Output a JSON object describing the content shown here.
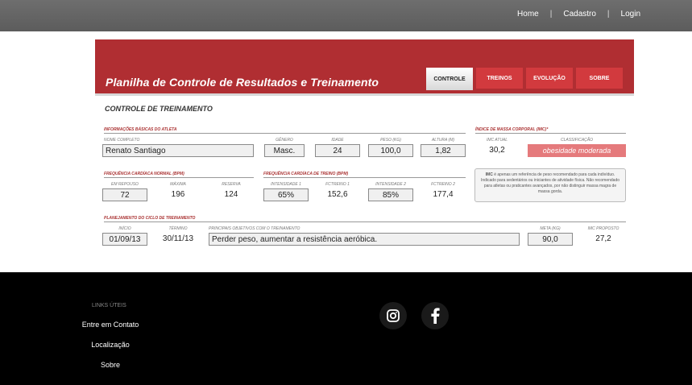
{
  "nav": {
    "home": "Home",
    "cadastro": "Cadastro",
    "login": "Login",
    "separator": "|"
  },
  "header": {
    "title": "Planilha de Controle de Resultados e Treinamento"
  },
  "tabs": [
    "CONTROLE",
    "TREINOS",
    "EVOLUÇÃO",
    "SOBRE"
  ],
  "section_title": "CONTROLE DE TREINAMENTO",
  "basic_info": {
    "label": "INFORMAÇÕES BÁSICAS DO ATLETA",
    "name_label": "NOME COMPLETO",
    "name": "Renato Santiago",
    "gender_label": "GÊNERO",
    "gender": "Masc.",
    "age_label": "IDADE",
    "age": "24",
    "weight_label": "PESO (KG)",
    "weight": "100,0",
    "height_label": "ALTURA (m)",
    "height": "1,82"
  },
  "bmi": {
    "label": "ÍNDICE DE MASSA CORPORAL (IMC)*",
    "current_label": "IMC ATUAL",
    "current": "30,2",
    "class_label": "CLASSIFICAÇÃO",
    "class": "obesidade moderada",
    "note_bold": "IMC",
    "note": " é apenas um referência de peso recomendado para cada indivíduo. Indicado para sedentários ou iniciantes de atividade física. Não recomendado para atletas ou praticantes avançados, por não distinguir massa magra de massa gorda."
  },
  "hr_normal": {
    "label": "FREQUÊNCIA CARDÍACA NORMAL (BPM)",
    "rest_label": "EM REPOUSO",
    "rest": "72",
    "max_label": "MÁXIMA",
    "max": "196",
    "reserve_label": "RESERVA",
    "reserve": "124"
  },
  "hr_training": {
    "label": "FREQUÊNCIA CARDÍACA DE TREINO (BPM)",
    "int1_label": "INTENSIDADE 1",
    "int1": "65%",
    "fc1_label": "FCTreino 1",
    "fc1": "152,6",
    "int2_label": "INTENSIDADE 2",
    "int2": "85%",
    "fc2_label": "FCTreino 2",
    "fc2": "177,4"
  },
  "planning": {
    "label": "PLANEJAMENTO DO CICLO DE TREINAMENTO",
    "start_label": "INÍCIO",
    "start": "01/09/13",
    "end_label": "TÉRMINO",
    "end": "30/11/13",
    "goals_label": "PRINCIPAIS OBJETIVOS COM O TREINAMENTO",
    "goals": "Perder peso, aumentar a resistência aeróbica.",
    "target_label": "META (KG)",
    "target": "90,0",
    "bmi_label": "IMC PROPOSTO",
    "bmi": "27,2"
  },
  "footer": {
    "links_title": "LINKS ÚTEIS",
    "links": [
      "Entre em Contato",
      "Localização",
      "Sobre"
    ]
  }
}
